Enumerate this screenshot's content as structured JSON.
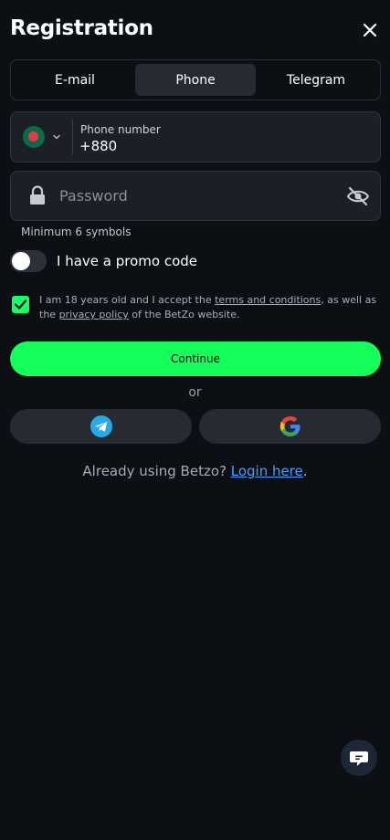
{
  "header": {
    "title": "Registration"
  },
  "tabs": [
    {
      "label": "E-mail"
    },
    {
      "label": "Phone"
    },
    {
      "label": "Telegram"
    }
  ],
  "active_tab": "Phone",
  "phone": {
    "label": "Phone number",
    "value": "+880"
  },
  "password": {
    "placeholder": "Password",
    "hint": "Minimum 6 symbols"
  },
  "promo": {
    "label": "I have a promo code",
    "enabled": false
  },
  "terms": {
    "checked": true,
    "text_1": "I am 18 years old and I accept the ",
    "link_terms": "terms and conditions",
    "text_2": ", as well as the ",
    "link_privacy": "privacy policy",
    "text_3": " of the BetZo website."
  },
  "buttons": {
    "continue": "Continue",
    "or": "or"
  },
  "login": {
    "prompt": "Already using Betzo? ",
    "link": "Login here",
    "suffix": "."
  },
  "colors": {
    "background": "#0c1015",
    "accent": "#14ff5a",
    "link": "#4a9dff",
    "telegram": "#29a9eb"
  },
  "icons": {
    "close": "close-icon",
    "flag": "bangladesh-flag-icon",
    "lock": "lock-icon",
    "eye": "eye-off-icon",
    "telegram": "telegram-icon",
    "google": "google-icon",
    "chat": "chat-icon"
  }
}
